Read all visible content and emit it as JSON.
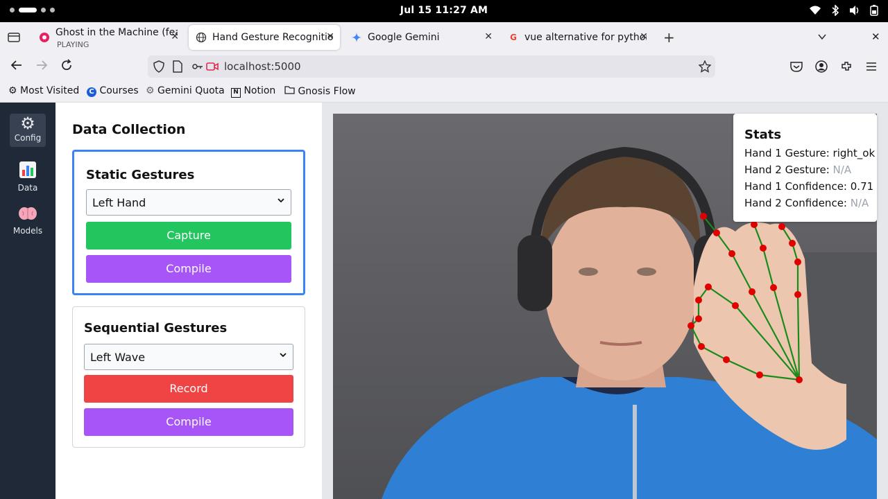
{
  "system": {
    "clock": "Jul 15  11:27 AM",
    "icons": [
      "wifi-icon",
      "bluetooth-icon",
      "volume-icon",
      "battery-icon"
    ]
  },
  "tabs": [
    {
      "title": "Ghost in the Machine (feat",
      "subtitle": "PLAYING",
      "active": false
    },
    {
      "title": "Hand Gesture Recognition",
      "active": true
    },
    {
      "title": "Google Gemini",
      "active": false
    },
    {
      "title": "vue alternative for python",
      "active": false
    }
  ],
  "address": {
    "url": "localhost:5000"
  },
  "bookmarks": [
    "Most Visited",
    "Courses",
    "Gemini Quota",
    "Notion",
    "Gnosis Flow"
  ],
  "sidebar": {
    "items": [
      {
        "label": "Config"
      },
      {
        "label": "Data"
      },
      {
        "label": "Models"
      }
    ]
  },
  "panel": {
    "title": "Data Collection",
    "static": {
      "heading": "Static Gestures",
      "selected": "Left Hand",
      "capture_label": "Capture",
      "compile_label": "Compile"
    },
    "sequential": {
      "heading": "Sequential Gestures",
      "selected": "Left Wave",
      "record_label": "Record",
      "compile_label": "Compile"
    }
  },
  "stats": {
    "title": "Stats",
    "hand1_gesture_label": "Hand 1 Gesture:",
    "hand1_gesture": "right_ok",
    "hand2_gesture_label": "Hand 2 Gesture:",
    "hand2_gesture": "N/A",
    "hand1_conf_label": "Hand 1 Confidence:",
    "hand1_conf": "0.71",
    "hand2_conf_label": "Hand 2 Confidence:",
    "hand2_conf": "N/A"
  },
  "colors": {
    "accent_blue": "#3b82f6",
    "green": "#22c55e",
    "purple": "#a855f7",
    "red": "#ef4444",
    "landmark": "#e00000",
    "skeleton": "#1a8a1a"
  }
}
